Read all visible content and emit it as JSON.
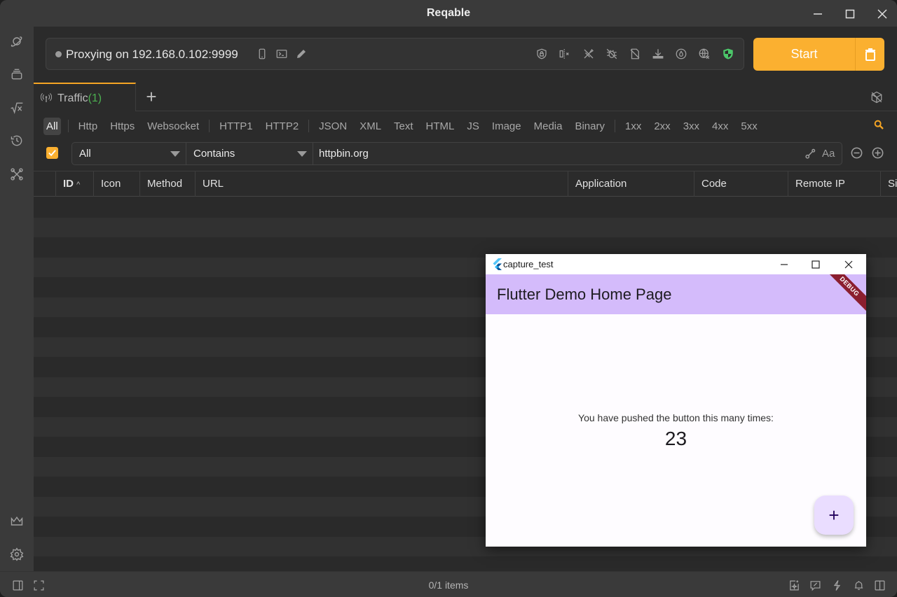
{
  "app": {
    "title": "Reqable",
    "window_controls": [
      "minimize",
      "maximize",
      "close"
    ]
  },
  "sidebar": {
    "items": [
      {
        "name": "planet-icon"
      },
      {
        "name": "collections-icon"
      },
      {
        "name": "sqrt-x-icon"
      },
      {
        "name": "history-icon"
      },
      {
        "name": "tools-icon"
      }
    ],
    "bottom_items": [
      {
        "name": "crown-icon"
      },
      {
        "name": "settings-icon"
      }
    ]
  },
  "proxy": {
    "status_text": "Proxying on 192.168.0.102:9999",
    "left_icons": [
      "mobile-icon",
      "terminal-icon",
      "edit-icon"
    ],
    "right_icons": [
      "ssl-lock-icon",
      "breakpoint-off-icon",
      "rewrite-off-icon",
      "debug-off-icon",
      "script-off-icon",
      "download-icon",
      "throttle-icon",
      "network-off-icon",
      "shield-icon"
    ],
    "shield_color": "#4cc76a",
    "start_label": "Start",
    "start_color": "#fbb030"
  },
  "tabs": {
    "items": [
      {
        "label": "Traffic",
        "count": "(1)",
        "active": true
      }
    ],
    "add_label": "+",
    "accent": "#f5a524"
  },
  "filters": {
    "groups": [
      [
        "All"
      ],
      [
        "Http",
        "Https",
        "Websocket"
      ],
      [
        "HTTP1",
        "HTTP2"
      ],
      [
        "JSON",
        "XML",
        "Text",
        "HTML",
        "JS",
        "Image",
        "Media",
        "Binary"
      ],
      [
        "1xx",
        "2xx",
        "3xx",
        "4xx",
        "5xx"
      ]
    ],
    "active": "All"
  },
  "query": {
    "enabled": true,
    "field": "All",
    "operator": "Contains",
    "value": "httpbin.org",
    "case_label": "Aa"
  },
  "table": {
    "columns": [
      "ID",
      "Icon",
      "Method",
      "URL",
      "Application",
      "Code",
      "Remote IP",
      "Si"
    ],
    "sort_column": "ID",
    "sort_dir": "asc",
    "rows": []
  },
  "status": {
    "items_count": "0/1 items"
  },
  "flutter_window": {
    "title": "capture_test",
    "appbar_title": "Flutter Demo Home Page",
    "debug_banner": "DEBUG",
    "body_label": "You have pushed the button this many times:",
    "counter": "23",
    "fab_label": "+",
    "appbar_color": "#d4bbfb",
    "fab_color": "#eaddff"
  }
}
